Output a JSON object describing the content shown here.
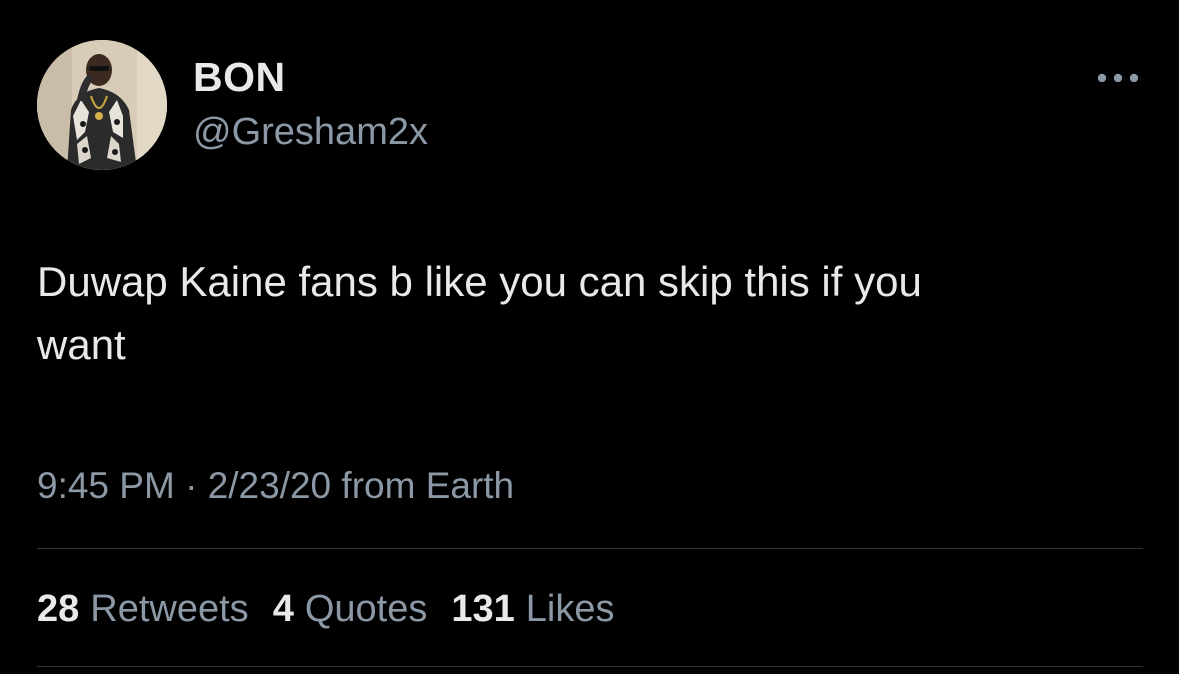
{
  "author": {
    "display_name": "BON",
    "handle": "@Gresham2x",
    "avatar_icon": "profile-photo"
  },
  "tweet": {
    "text": "Duwap Kaine fans b like you can skip this if you\nwant",
    "time": "9:45 PM",
    "separator": "·",
    "date": "2/23/20",
    "source": "from Earth"
  },
  "stats": {
    "retweets": {
      "count": "28",
      "label": "Retweets"
    },
    "quotes": {
      "count": "4",
      "label": "Quotes"
    },
    "likes": {
      "count": "131",
      "label": "Likes"
    }
  },
  "icons": {
    "more": "more-options-icon"
  },
  "colors": {
    "background": "#000000",
    "primary_text": "#e7e9ea",
    "secondary_text": "#8b98a5",
    "divider": "#2f3336"
  }
}
